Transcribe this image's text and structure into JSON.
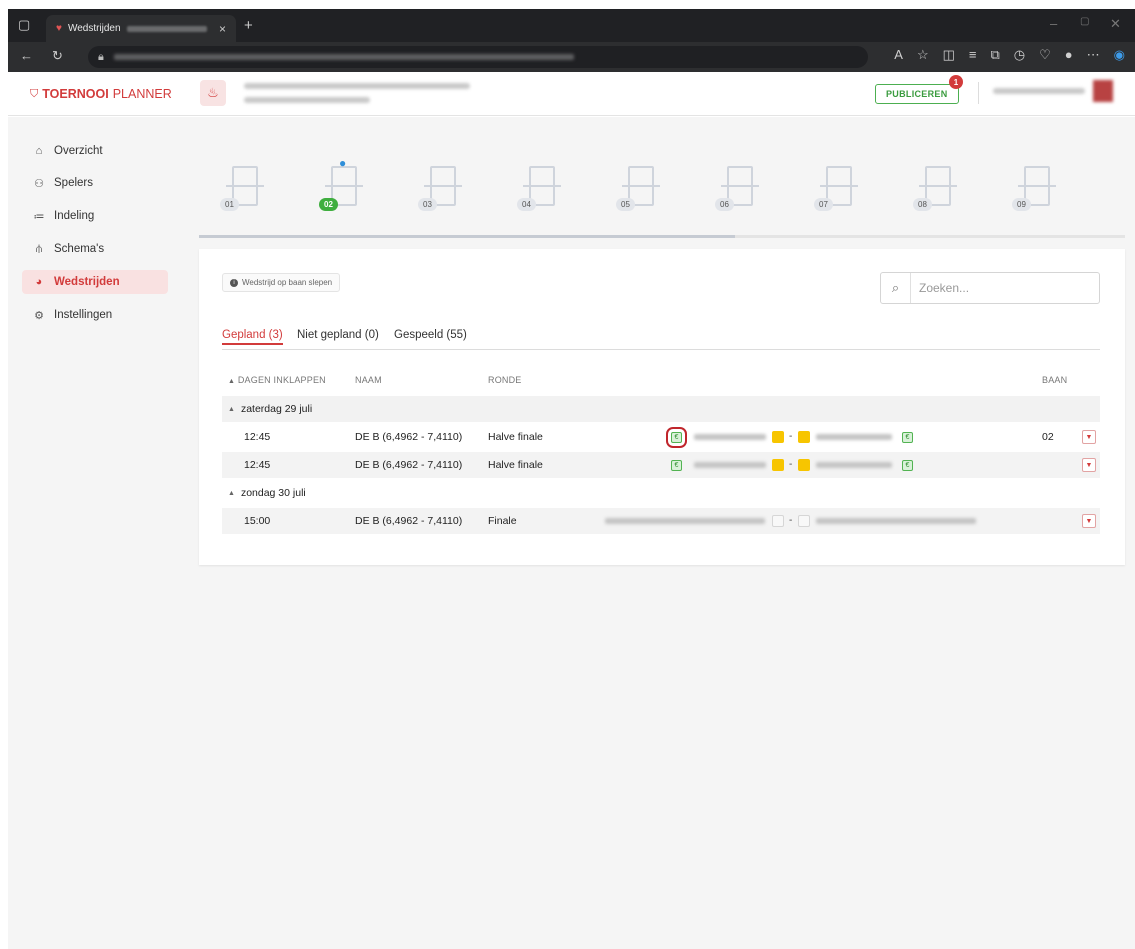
{
  "browser": {
    "tab_title": "Wedstrijden",
    "tab_close": "×",
    "new_tab": "+"
  },
  "header": {
    "logo_bold": "TOERNOOI",
    "logo_rest": "PLANNER",
    "publish_label": "PUBLICEREN",
    "publish_count": "1"
  },
  "sidebar": {
    "items": [
      {
        "label": "Overzicht",
        "icon": "home-icon",
        "active": false
      },
      {
        "label": "Spelers",
        "icon": "players-icon",
        "active": false
      },
      {
        "label": "Indeling",
        "icon": "list-icon",
        "active": false
      },
      {
        "label": "Schema's",
        "icon": "bracket-icon",
        "active": false
      },
      {
        "label": "Wedstrijden",
        "icon": "matches-icon",
        "active": true
      },
      {
        "label": "Instellingen",
        "icon": "gear-icon",
        "active": false
      }
    ]
  },
  "courts": [
    {
      "number": "01",
      "occupied": false
    },
    {
      "number": "02",
      "occupied": true
    },
    {
      "number": "03",
      "occupied": false
    },
    {
      "number": "04",
      "occupied": false
    },
    {
      "number": "05",
      "occupied": false
    },
    {
      "number": "06",
      "occupied": false
    },
    {
      "number": "07",
      "occupied": false
    },
    {
      "number": "08",
      "occupied": false
    },
    {
      "number": "09",
      "occupied": false
    }
  ],
  "main": {
    "hint": "Wedstrijd op baan slepen",
    "search_placeholder": "Zoeken...",
    "tabs": [
      {
        "label": "Gepland (3)",
        "active": true
      },
      {
        "label": "Niet gepland (0)",
        "active": false
      },
      {
        "label": "Gespeeld (55)",
        "active": false
      }
    ],
    "columns": {
      "collapse": "DAGEN INKLAPPEN",
      "naam": "NAAM",
      "ronde": "RONDE",
      "baan": "BAAN"
    },
    "days": [
      {
        "label": "zaterdag 29 juli",
        "matches": [
          {
            "time": "12:45",
            "naam": "DE B (6,4962 - 7,4110)",
            "ronde": "Halve finale",
            "baan": "02"
          },
          {
            "time": "12:45",
            "naam": "DE B (6,4962 - 7,4110)",
            "ronde": "Halve finale",
            "baan": ""
          }
        ]
      },
      {
        "label": "zondag 30 juli",
        "matches": [
          {
            "time": "15:00",
            "naam": "DE B (6,4962 - 7,4110)",
            "ronde": "Finale",
            "baan": ""
          }
        ]
      }
    ]
  },
  "colors": {
    "brand": "#d23b3b",
    "paid": "#52b352",
    "present": "#f7c500"
  }
}
